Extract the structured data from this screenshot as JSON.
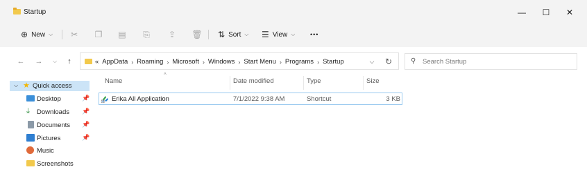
{
  "window": {
    "title": "Startup",
    "minimize_glyph": "—",
    "maximize_glyph": "☐",
    "close_glyph": "✕"
  },
  "toolbar": {
    "new_label": "New",
    "sort_label": "Sort",
    "view_label": "View",
    "more_glyph": "•••",
    "icons": [
      "cut-icon",
      "copy-icon",
      "paste-icon",
      "rename-icon",
      "share-icon",
      "delete-icon"
    ]
  },
  "address": {
    "overflow_glyph": "«",
    "breadcrumb": [
      "AppData",
      "Roaming",
      "Microsoft",
      "Windows",
      "Start Menu",
      "Programs",
      "Startup"
    ]
  },
  "search": {
    "placeholder": "Search Startup"
  },
  "nav": {
    "quick_access_label": "Quick access",
    "items": [
      {
        "label": "Desktop",
        "pinned": true,
        "icon": "desktop-icon"
      },
      {
        "label": "Downloads",
        "pinned": true,
        "icon": "download-icon"
      },
      {
        "label": "Documents",
        "pinned": true,
        "icon": "documents-icon"
      },
      {
        "label": "Pictures",
        "pinned": true,
        "icon": "pictures-icon"
      },
      {
        "label": "Music",
        "pinned": false,
        "icon": "music-icon"
      },
      {
        "label": "Screenshots",
        "pinned": false,
        "icon": "folder-icon"
      }
    ]
  },
  "columns": {
    "name": "Name",
    "date_modified": "Date modified",
    "type": "Type",
    "size": "Size"
  },
  "files": [
    {
      "name": "Erika All Application",
      "date_modified": "7/1/2022 9:38 AM",
      "type": "Shortcut",
      "size": "3 KB"
    }
  ],
  "colors": {
    "selection": "#cce4f7",
    "row_border": "#99c9ef",
    "folder": "#f2c94c",
    "chrome": "#f3f3f3"
  }
}
